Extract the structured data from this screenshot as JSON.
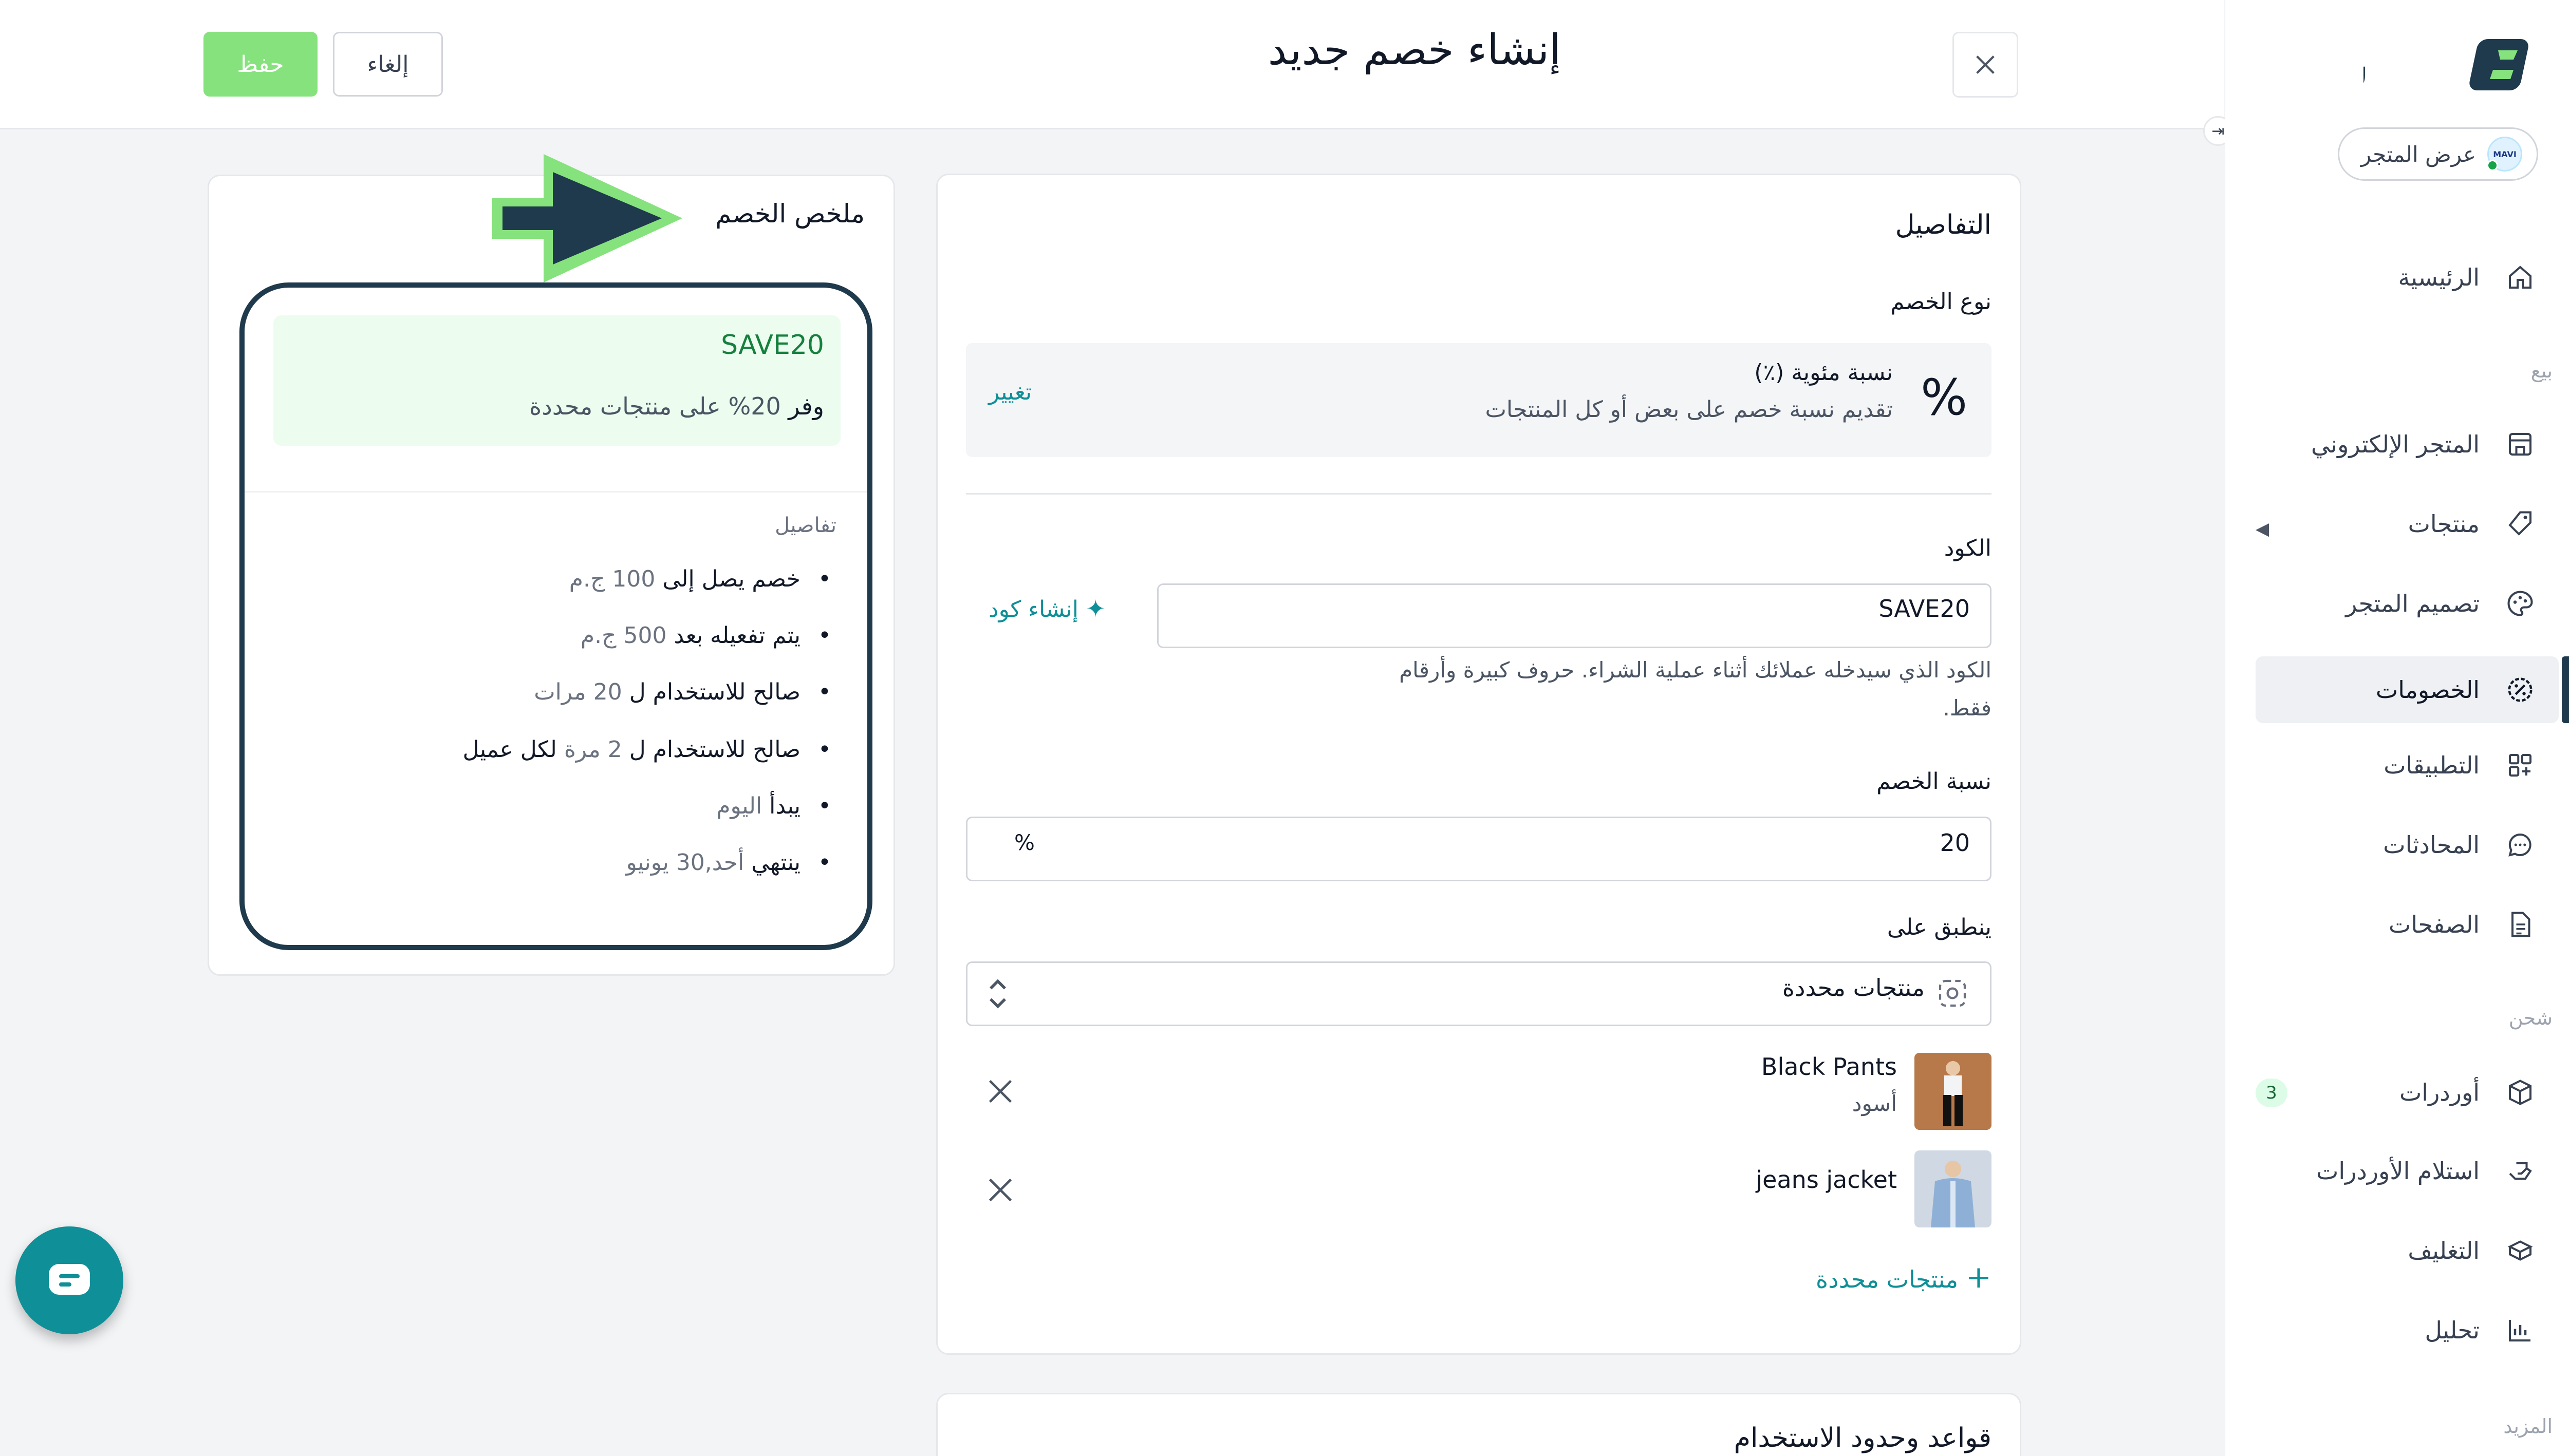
{
  "topbar": {
    "title": "إنشاء خصم جديد",
    "save_label": "حفظ",
    "cancel_label": "إلغاء"
  },
  "sidebar": {
    "brand": "سلر",
    "store_button": "عرض المتجر",
    "store_avatar": "MAVI",
    "items": [
      {
        "label": "الرئيسية",
        "icon": "home-icon"
      },
      {
        "label": "المتجر الإلكتروني",
        "icon": "storefront-icon"
      },
      {
        "label": "منتجات",
        "icon": "tag-icon"
      },
      {
        "label": "تصميم المتجر",
        "icon": "palette-icon"
      },
      {
        "label": "الخصومات",
        "icon": "discount-icon"
      },
      {
        "label": "التطبيقات",
        "icon": "apps-icon"
      },
      {
        "label": "المحادثات",
        "icon": "chat-icon"
      },
      {
        "label": "الصفحات",
        "icon": "page-icon"
      },
      {
        "label": "أوردرات",
        "icon": "box-icon"
      },
      {
        "label": "استلام الأوردرات",
        "icon": "pickup-icon"
      },
      {
        "label": "التغليف",
        "icon": "package-icon"
      },
      {
        "label": "تحليل",
        "icon": "analytics-icon"
      }
    ],
    "sections": {
      "sell": "بيع",
      "shipping": "شحن",
      "more": "المزيد"
    },
    "orders_badge": "3"
  },
  "details": {
    "heading": "التفاصيل",
    "type_label": "نوع الخصم",
    "type_title": "نسبة مئوية (٪)",
    "type_desc": "تقديم نسبة خصم على بعض أو كل المنتجات",
    "change_link": "تغيير",
    "code_label": "الكود",
    "code_value": "SAVE20",
    "generate_code": "إنشاء كود",
    "code_help_1": "الكود الذي سيدخله عملائك أثناء عملية الشراء. حروف كبيرة وأرقام",
    "code_help_2": "فقط.",
    "percent_label": "نسبة الخصم",
    "percent_value": "20",
    "percent_suffix": "%",
    "applies_label": "ينطبق على",
    "applies_value": "منتجات محددة",
    "products": [
      {
        "name": "Black Pants",
        "variant": "أسود"
      },
      {
        "name": "jeans jacket",
        "variant": ""
      }
    ],
    "add_products": "منتجات محددة",
    "rules_heading": "قواعد وحدود الاستخدام"
  },
  "summary": {
    "heading": "ملخص الخصم",
    "code": "SAVE20",
    "offer_prefix": "وفر",
    "offer_value": "20%",
    "offer_rest": "على منتجات محددة",
    "details_label": "تفاصيل",
    "items": [
      {
        "main": "خصم يصل إلى",
        "muted": "100 ج.م"
      },
      {
        "main": "يتم تفعيله بعد",
        "muted": "500 ج.م"
      },
      {
        "main": "صالح للاستخدام ل",
        "muted": "20 مرات"
      },
      {
        "main": "صالح للاستخدام ل",
        "muted": "2 مرة",
        "tail": "لكل عميل"
      },
      {
        "main": "يبدأ",
        "muted": "اليوم"
      },
      {
        "main": "ينتهي",
        "muted": "أحد,30 يونيو"
      }
    ]
  },
  "colors": {
    "accent": "#0f8f97",
    "brand_dark": "#1e3a4c",
    "save_green": "#86e27d",
    "link": "#0f8f97"
  }
}
